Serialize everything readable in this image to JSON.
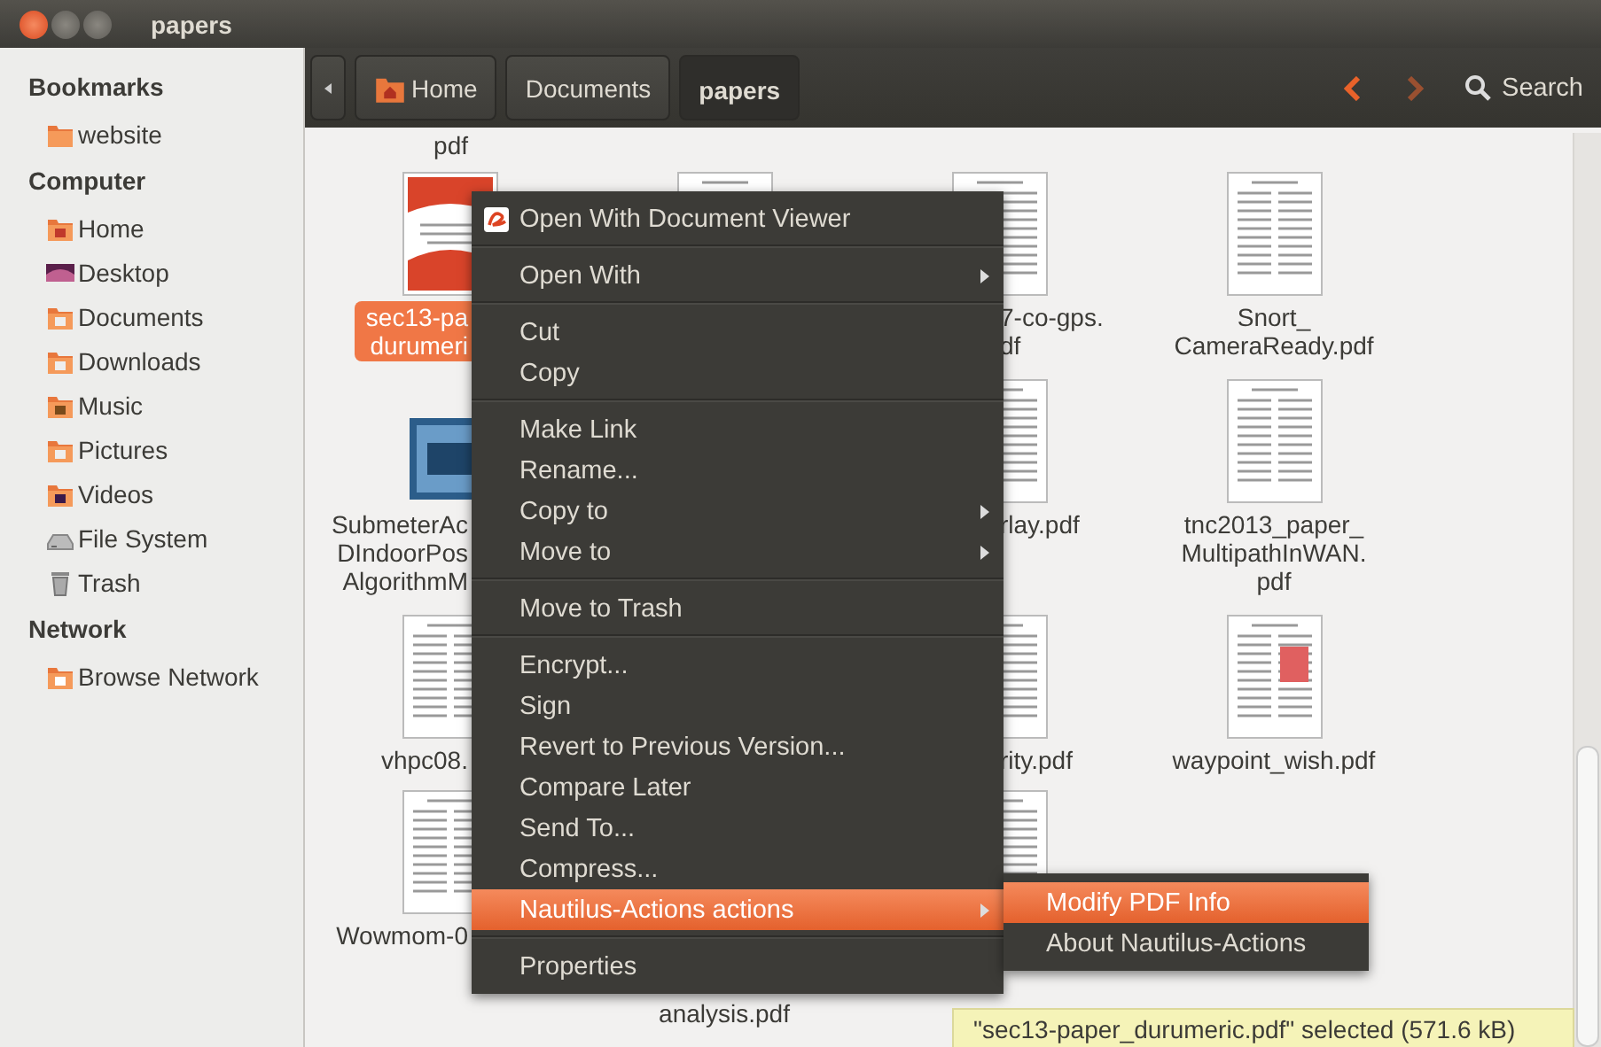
{
  "window": {
    "title": "papers"
  },
  "sidebar": {
    "sections": [
      {
        "heading": "Bookmarks",
        "items": [
          {
            "label": "website",
            "kind": "folder"
          }
        ]
      },
      {
        "heading": "Computer",
        "items": [
          {
            "label": "Home",
            "kind": "home"
          },
          {
            "label": "Desktop",
            "kind": "desktop"
          },
          {
            "label": "Documents",
            "kind": "documents"
          },
          {
            "label": "Downloads",
            "kind": "downloads"
          },
          {
            "label": "Music",
            "kind": "music"
          },
          {
            "label": "Pictures",
            "kind": "pictures"
          },
          {
            "label": "Videos",
            "kind": "videos"
          },
          {
            "label": "File System",
            "kind": "drive"
          },
          {
            "label": "Trash",
            "kind": "trash"
          }
        ]
      },
      {
        "heading": "Network",
        "items": [
          {
            "label": "Browse Network",
            "kind": "network"
          }
        ]
      }
    ]
  },
  "breadcrumbs": [
    {
      "label": "Home",
      "kind": "home",
      "selected": false
    },
    {
      "label": "Documents",
      "kind": "folder",
      "selected": false
    },
    {
      "label": "papers",
      "kind": "folder",
      "selected": true
    }
  ],
  "search": {
    "label": "Search"
  },
  "files": [
    [
      {
        "kind": "none",
        "lines": [
          "pdf"
        ],
        "selected": false
      },
      {
        "kind": "empty"
      },
      {
        "kind": "empty"
      },
      {
        "kind": "empty"
      }
    ],
    [
      {
        "kind": "sec13",
        "lines": [
          "sec13-pa",
          "durumeri"
        ],
        "selected": true
      },
      {
        "kind": "paper"
      },
      {
        "kind": "paper",
        "lines": [
          "7-co-gps.",
          "df"
        ],
        "selected": false
      },
      {
        "kind": "paper",
        "lines": [
          "Snort_",
          "CameraReady.pdf"
        ],
        "selected": false
      }
    ],
    [
      {
        "kind": "word",
        "lines": [
          "SubmeterAc",
          "DIndoorPos",
          "AlgorithmM"
        ],
        "selected": false
      },
      {
        "kind": "empty"
      },
      {
        "kind": "paper",
        "lines": [
          "rlay.pdf"
        ],
        "selected": false
      },
      {
        "kind": "paper",
        "lines": [
          "tnc2013_paper_",
          "MultipathInWAN.",
          "pdf"
        ],
        "selected": false
      }
    ],
    [
      {
        "kind": "paper",
        "lines": [
          "vhpc08."
        ],
        "selected": false
      },
      {
        "kind": "empty"
      },
      {
        "kind": "paper",
        "lines": [
          "rity.pdf"
        ],
        "selected": false
      },
      {
        "kind": "figure",
        "lines": [
          "waypoint_wish.pdf"
        ],
        "selected": false
      }
    ],
    [
      {
        "kind": "paper",
        "lines": [
          "Wowmom-0"
        ],
        "selected": false
      },
      {
        "kind": "none",
        "lines": [
          "analysis.pdf"
        ],
        "selected": false
      },
      {
        "kind": "paper"
      },
      {
        "kind": "empty"
      }
    ]
  ],
  "context_menu": [
    {
      "kind": "app",
      "label": "Open With Document Viewer",
      "submenu": false,
      "selected": false
    },
    {
      "kind": "separator"
    },
    {
      "kind": "item",
      "label": "Open With",
      "submenu": true,
      "selected": false
    },
    {
      "kind": "separator"
    },
    {
      "kind": "item",
      "label": "Cut",
      "submenu": false,
      "selected": false
    },
    {
      "kind": "item",
      "label": "Copy",
      "submenu": false,
      "selected": false
    },
    {
      "kind": "separator"
    },
    {
      "kind": "item",
      "label": "Make Link",
      "submenu": false,
      "selected": false
    },
    {
      "kind": "item",
      "label": "Rename...",
      "submenu": false,
      "selected": false
    },
    {
      "kind": "item",
      "label": "Copy to",
      "submenu": true,
      "selected": false
    },
    {
      "kind": "item",
      "label": "Move to",
      "submenu": true,
      "selected": false
    },
    {
      "kind": "separator"
    },
    {
      "kind": "item",
      "label": "Move to Trash",
      "submenu": false,
      "selected": false
    },
    {
      "kind": "separator"
    },
    {
      "kind": "item",
      "label": "Encrypt...",
      "submenu": false,
      "selected": false
    },
    {
      "kind": "item",
      "label": "Sign",
      "submenu": false,
      "selected": false
    },
    {
      "kind": "item",
      "label": "Revert to Previous Version...",
      "submenu": false,
      "selected": false
    },
    {
      "kind": "item",
      "label": "Compare Later",
      "submenu": false,
      "selected": false
    },
    {
      "kind": "item",
      "label": "Send To...",
      "submenu": false,
      "selected": false
    },
    {
      "kind": "item",
      "label": "Compress...",
      "submenu": false,
      "selected": false
    },
    {
      "kind": "item",
      "label": "Nautilus-Actions actions",
      "submenu": true,
      "selected": true
    },
    {
      "kind": "separator"
    },
    {
      "kind": "item",
      "label": "Properties",
      "submenu": false,
      "selected": false
    }
  ],
  "submenu": [
    {
      "label": "Modify PDF Info",
      "selected": true
    },
    {
      "label": "About Nautilus-Actions",
      "selected": false
    }
  ],
  "status": "\"sec13-paper_durumeric.pdf\" selected (571.6 kB)"
}
